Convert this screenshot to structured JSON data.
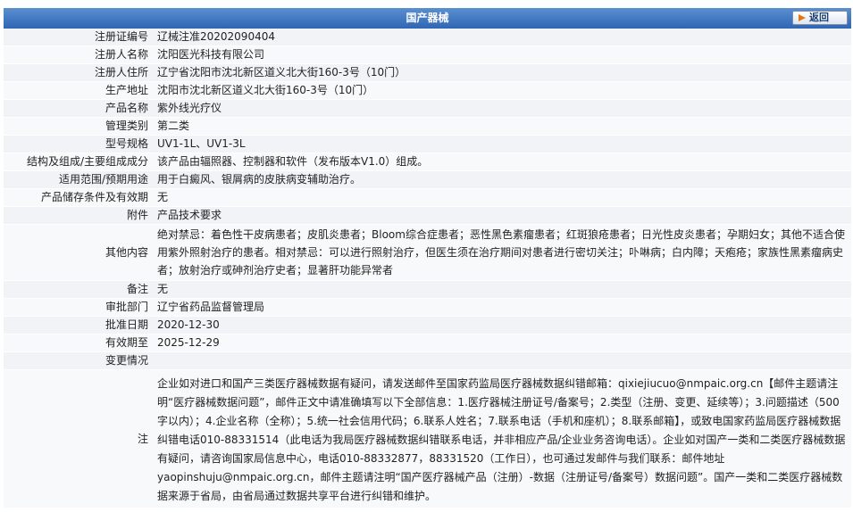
{
  "header": {
    "title": "国产器械",
    "back_label": "返回"
  },
  "fields": {
    "reg_no": {
      "label": "注册证编号",
      "value": "辽械注准20202090404"
    },
    "registrant": {
      "label": "注册人名称",
      "value": "沈阳医光科技有限公司"
    },
    "registrant_addr": {
      "label": "注册人住所",
      "value": "辽宁省沈阳市沈北新区道义北大街160-3号（10门）"
    },
    "prod_addr": {
      "label": "生产地址",
      "value": "沈阳市沈北新区道义北大街160-3号（10门）"
    },
    "product_name": {
      "label": "产品名称",
      "value": "紫外线光疗仪"
    },
    "category": {
      "label": "管理类别",
      "value": "第二类"
    },
    "model": {
      "label": "型号规格",
      "value": "UV1-1L、UV1-3L"
    },
    "structure": {
      "label": "结构及组成/主要组成成分",
      "value": "该产品由辐照器、控制器和软件（发布版本V1.0）组成。"
    },
    "scope": {
      "label": "适用范围/预期用途",
      "value": "用于白癜风、银屑病的皮肤病变辅助治疗。"
    },
    "storage": {
      "label": "产品储存条件及有效期",
      "value": "无"
    },
    "attachment": {
      "label": "附件",
      "value": "产品技术要求"
    },
    "other": {
      "label": "其他内容",
      "value": "绝对禁忌：着色性干皮病患者；皮肌炎患者；Bloom综合症患者；恶性黑色素瘤患者；红斑狼疮患者；日光性皮炎患者；孕期妇女；其他不适合使用紫外照射治疗的患者。相对禁忌：可以进行照射治疗，但医生须在治疗期间对患者进行密切关注；卟啉病；白内障；天疱疮；家族性黑素瘤病史者；放射治疗或砷剂治疗史者；显著肝功能异常者"
    },
    "remark": {
      "label": "备注",
      "value": "无"
    },
    "dept": {
      "label": "审批部门",
      "value": "辽宁省药品监督管理局"
    },
    "approve_date": {
      "label": "批准日期",
      "value": "2020-12-30"
    },
    "expiry": {
      "label": "有效期至",
      "value": "2025-12-29"
    },
    "change": {
      "label": "变更情况",
      "value": ""
    },
    "note": {
      "label": "注",
      "value": "企业如对进口和国产三类医疗器械数据有疑问，请发送邮件至国家药监局医疗器械数据纠错邮箱：qixiejiucuo@nmpaic.org.cn【邮件主题请注明“医疗器械数据问题”，邮件正文中请准确填写以下全部信息：1.医疗器械注册证号/备案号；2.类型（注册、变更、延续等）；3.问题描述（500字以内）；4.企业名称（全称）；5.统一社会信用代码；6.联系人姓名；7.联系电话（手机和座机）；8.联系邮箱】，或致电国家药监局医疗器械数据纠错电话010-88331514（此电话为我局医疗器械数据纠错联系电话，并非相应产品/企业业务咨询电话）。企业如对国产一类和二类医疗器械数据有疑问，请咨询国家局信息中心，电话010-88332877，88331520（工作日），也可通过发邮件与我们联系：邮件地址yaopinshuju@nmpaic.org.cn，邮件主题请注明“国产医疗器械产品（注册）-数据（注册证号/备案号）数据问题”。国产一类和二类医疗器械数据来源于省局，由省局通过数据共享平台进行纠错和维护。"
    }
  }
}
